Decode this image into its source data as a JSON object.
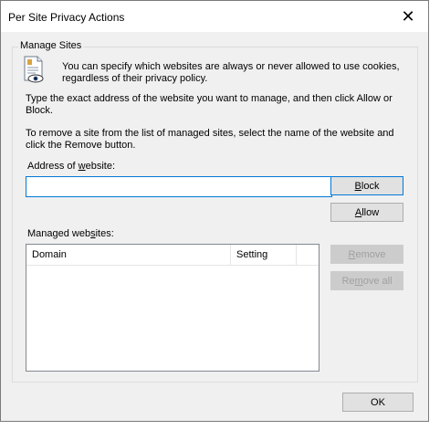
{
  "dialog": {
    "title": "Per Site Privacy Actions",
    "close_symbol": "✕"
  },
  "group": {
    "label": "Manage Sites",
    "info_text": "You can specify which websites are always or never allowed to use cookies, regardless of their privacy policy.",
    "instructions_1": "Type the exact address of the website you want to manage, and then click Allow or Block.",
    "instructions_2": "To remove a site from the list of managed sites, select the name of the website and click the Remove button."
  },
  "address": {
    "label_before": "Address of ",
    "label_access": "w",
    "label_after": "ebsite:",
    "value": ""
  },
  "buttons": {
    "block_access": "B",
    "block_rest": "lock",
    "allow_access": "A",
    "allow_rest": "llow",
    "remove_access": "R",
    "remove_rest": "emove",
    "remove_all_before": "Re",
    "remove_all_access": "m",
    "remove_all_after": "ove all",
    "ok": "OK"
  },
  "managed": {
    "label_before": "Managed web",
    "label_access": "s",
    "label_after": "ites:",
    "columns": [
      "Domain",
      "Setting"
    ],
    "rows": []
  },
  "icons": {
    "info": "privacy-document-eye-icon",
    "close": "close-icon"
  },
  "colors": {
    "focus_border": "#0078d7",
    "dialog_bg": "#f0f0f0",
    "button_bg": "#e1e1e1",
    "disabled_text": "#a0a0a0"
  }
}
